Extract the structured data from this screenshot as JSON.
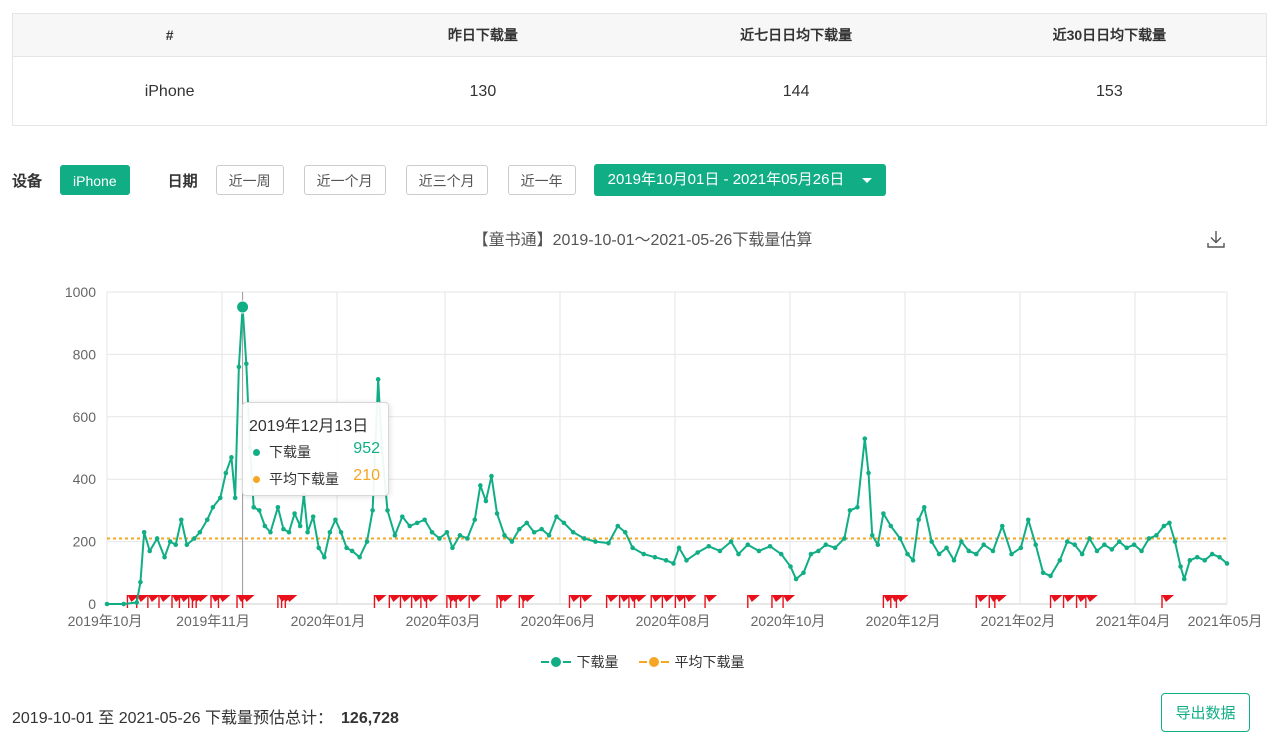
{
  "summary": {
    "headers": [
      "#",
      "昨日下载量",
      "近七日日均下载量",
      "近30日日均下载量"
    ],
    "row": [
      "iPhone",
      "130",
      "144",
      "153"
    ]
  },
  "filters": {
    "device_label": "设备",
    "device_selected": "iPhone",
    "date_label": "日期",
    "quick_ranges": [
      "近一周",
      "近一个月",
      "近三个月",
      "近一年"
    ],
    "date_range": "2019年10月01日 - 2021年05月26日"
  },
  "download_icon": "download-icon",
  "colors": {
    "accent": "#11ae86",
    "average": "#f5a623",
    "flag": "#e8101a"
  },
  "tooltip": {
    "date": "2019年12月13日",
    "rows": [
      {
        "name": "下载量",
        "value": "952"
      },
      {
        "name": "平均下载量",
        "value": "210"
      }
    ]
  },
  "footer": {
    "text": "2019-10-01 至 2021-05-26 下载量预估总计：",
    "total": "126,728",
    "export_label": "导出数据"
  },
  "chart_data": {
    "type": "line",
    "title": "【童书通】2019-10-01～2021-05-26下载量估算",
    "xlabel": "",
    "ylabel": "",
    "ylim": [
      0,
      1000
    ],
    "yticks": [
      0,
      200,
      400,
      600,
      800,
      1000
    ],
    "x_start": "2019-10-01",
    "x_end": "2021-05-26",
    "xticks": [
      "2019年10月",
      "2019年11月",
      "2020年01月",
      "2020年03月",
      "2020年06月",
      "2020年08月",
      "2020年10月",
      "2020年12月",
      "2021年02月",
      "2021年04月",
      "2021年05月"
    ],
    "grid": true,
    "legend_position": "bottom",
    "series": [
      {
        "name": "下载量",
        "color": "#11ae86",
        "points": [
          [
            "2019-10-01",
            0
          ],
          [
            "2019-10-10",
            0
          ],
          [
            "2019-10-17",
            5
          ],
          [
            "2019-10-19",
            70
          ],
          [
            "2019-10-21",
            230
          ],
          [
            "2019-10-24",
            170
          ],
          [
            "2019-10-28",
            210
          ],
          [
            "2019-11-01",
            150
          ],
          [
            "2019-11-04",
            200
          ],
          [
            "2019-11-07",
            190
          ],
          [
            "2019-11-10",
            270
          ],
          [
            "2019-11-13",
            190
          ],
          [
            "2019-11-17",
            210
          ],
          [
            "2019-11-20",
            230
          ],
          [
            "2019-11-24",
            270
          ],
          [
            "2019-11-27",
            310
          ],
          [
            "2019-12-01",
            340
          ],
          [
            "2019-12-04",
            420
          ],
          [
            "2019-12-07",
            470
          ],
          [
            "2019-12-09",
            340
          ],
          [
            "2019-12-11",
            760
          ],
          [
            "2019-12-13",
            952
          ],
          [
            "2019-12-15",
            770
          ],
          [
            "2019-12-17",
            500
          ],
          [
            "2019-12-19",
            310
          ],
          [
            "2019-12-22",
            300
          ],
          [
            "2019-12-25",
            250
          ],
          [
            "2019-12-28",
            230
          ],
          [
            "2020-01-01",
            310
          ],
          [
            "2020-01-04",
            240
          ],
          [
            "2020-01-07",
            230
          ],
          [
            "2020-01-10",
            290
          ],
          [
            "2020-01-13",
            250
          ],
          [
            "2020-01-15",
            350
          ],
          [
            "2020-01-17",
            230
          ],
          [
            "2020-01-20",
            280
          ],
          [
            "2020-01-23",
            180
          ],
          [
            "2020-01-26",
            150
          ],
          [
            "2020-01-29",
            230
          ],
          [
            "2020-02-01",
            270
          ],
          [
            "2020-02-04",
            230
          ],
          [
            "2020-02-07",
            180
          ],
          [
            "2020-02-10",
            170
          ],
          [
            "2020-02-14",
            150
          ],
          [
            "2020-02-18",
            200
          ],
          [
            "2020-02-21",
            300
          ],
          [
            "2020-02-24",
            720
          ],
          [
            "2020-02-26",
            500
          ],
          [
            "2020-02-29",
            300
          ],
          [
            "2020-03-04",
            220
          ],
          [
            "2020-03-08",
            280
          ],
          [
            "2020-03-12",
            250
          ],
          [
            "2020-03-16",
            260
          ],
          [
            "2020-03-20",
            270
          ],
          [
            "2020-03-24",
            230
          ],
          [
            "2020-03-28",
            210
          ],
          [
            "2020-04-01",
            230
          ],
          [
            "2020-04-04",
            180
          ],
          [
            "2020-04-08",
            220
          ],
          [
            "2020-04-12",
            210
          ],
          [
            "2020-04-16",
            270
          ],
          [
            "2020-04-19",
            380
          ],
          [
            "2020-04-22",
            330
          ],
          [
            "2020-04-25",
            410
          ],
          [
            "2020-04-28",
            290
          ],
          [
            "2020-05-02",
            220
          ],
          [
            "2020-05-06",
            200
          ],
          [
            "2020-05-10",
            240
          ],
          [
            "2020-05-14",
            260
          ],
          [
            "2020-05-18",
            230
          ],
          [
            "2020-05-22",
            240
          ],
          [
            "2020-05-26",
            220
          ],
          [
            "2020-05-30",
            280
          ],
          [
            "2020-06-03",
            260
          ],
          [
            "2020-06-08",
            230
          ],
          [
            "2020-06-14",
            210
          ],
          [
            "2020-06-20",
            200
          ],
          [
            "2020-06-27",
            195
          ],
          [
            "2020-07-02",
            250
          ],
          [
            "2020-07-06",
            230
          ],
          [
            "2020-07-10",
            180
          ],
          [
            "2020-07-16",
            160
          ],
          [
            "2020-07-22",
            150
          ],
          [
            "2020-07-28",
            140
          ],
          [
            "2020-08-01",
            130
          ],
          [
            "2020-08-04",
            180
          ],
          [
            "2020-08-08",
            140
          ],
          [
            "2020-08-14",
            165
          ],
          [
            "2020-08-20",
            185
          ],
          [
            "2020-08-26",
            170
          ],
          [
            "2020-09-01",
            200
          ],
          [
            "2020-09-05",
            160
          ],
          [
            "2020-09-10",
            190
          ],
          [
            "2020-09-16",
            170
          ],
          [
            "2020-09-22",
            185
          ],
          [
            "2020-09-28",
            160
          ],
          [
            "2020-10-03",
            120
          ],
          [
            "2020-10-06",
            80
          ],
          [
            "2020-10-10",
            100
          ],
          [
            "2020-10-14",
            160
          ],
          [
            "2020-10-18",
            170
          ],
          [
            "2020-10-22",
            190
          ],
          [
            "2020-10-27",
            180
          ],
          [
            "2020-11-01",
            210
          ],
          [
            "2020-11-04",
            300
          ],
          [
            "2020-11-08",
            310
          ],
          [
            "2020-11-12",
            530
          ],
          [
            "2020-11-14",
            420
          ],
          [
            "2020-11-16",
            220
          ],
          [
            "2020-11-19",
            190
          ],
          [
            "2020-11-22",
            290
          ],
          [
            "2020-11-26",
            250
          ],
          [
            "2020-12-01",
            210
          ],
          [
            "2020-12-05",
            160
          ],
          [
            "2020-12-08",
            140
          ],
          [
            "2020-12-11",
            270
          ],
          [
            "2020-12-14",
            310
          ],
          [
            "2020-12-18",
            200
          ],
          [
            "2020-12-22",
            160
          ],
          [
            "2020-12-26",
            180
          ],
          [
            "2020-12-30",
            140
          ],
          [
            "2021-01-03",
            200
          ],
          [
            "2021-01-07",
            170
          ],
          [
            "2021-01-11",
            160
          ],
          [
            "2021-01-15",
            190
          ],
          [
            "2021-01-20",
            170
          ],
          [
            "2021-01-25",
            250
          ],
          [
            "2021-01-30",
            160
          ],
          [
            "2021-02-04",
            180
          ],
          [
            "2021-02-08",
            270
          ],
          [
            "2021-02-12",
            190
          ],
          [
            "2021-02-16",
            100
          ],
          [
            "2021-02-20",
            90
          ],
          [
            "2021-02-25",
            140
          ],
          [
            "2021-03-01",
            200
          ],
          [
            "2021-03-05",
            190
          ],
          [
            "2021-03-09",
            160
          ],
          [
            "2021-03-13",
            210
          ],
          [
            "2021-03-17",
            170
          ],
          [
            "2021-03-21",
            190
          ],
          [
            "2021-03-25",
            175
          ],
          [
            "2021-03-29",
            200
          ],
          [
            "2021-04-02",
            180
          ],
          [
            "2021-04-06",
            190
          ],
          [
            "2021-04-10",
            170
          ],
          [
            "2021-04-14",
            210
          ],
          [
            "2021-04-18",
            220
          ],
          [
            "2021-04-22",
            250
          ],
          [
            "2021-04-25",
            260
          ],
          [
            "2021-04-28",
            200
          ],
          [
            "2021-05-01",
            120
          ],
          [
            "2021-05-03",
            80
          ],
          [
            "2021-05-06",
            140
          ],
          [
            "2021-05-10",
            150
          ],
          [
            "2021-05-14",
            140
          ],
          [
            "2021-05-18",
            160
          ],
          [
            "2021-05-22",
            150
          ],
          [
            "2021-05-26",
            130
          ]
        ]
      },
      {
        "name": "平均下载量",
        "color": "#f5a623",
        "constant": 210
      }
    ],
    "flag_dates": [
      "2019-10-12",
      "2019-10-17",
      "2019-10-23",
      "2019-10-29",
      "2019-11-05",
      "2019-11-09",
      "2019-11-14",
      "2019-11-16",
      "2019-11-18",
      "2019-11-26",
      "2019-11-30",
      "2019-12-10",
      "2019-12-13",
      "2020-01-01",
      "2020-01-03",
      "2020-01-05",
      "2020-02-22",
      "2020-03-01",
      "2020-03-07",
      "2020-03-13",
      "2020-03-18",
      "2020-03-21",
      "2020-04-01",
      "2020-04-03",
      "2020-04-06",
      "2020-04-13",
      "2020-04-28",
      "2020-04-30",
      "2020-05-10",
      "2020-05-12",
      "2020-06-06",
      "2020-06-12",
      "2020-06-26",
      "2020-07-03",
      "2020-07-08",
      "2020-07-11",
      "2020-07-20",
      "2020-07-26",
      "2020-08-02",
      "2020-08-07",
      "2020-08-18",
      "2020-09-10",
      "2020-09-23",
      "2020-09-29",
      "2020-11-22",
      "2020-11-26",
      "2020-11-29",
      "2021-01-11",
      "2021-01-18",
      "2021-01-21",
      "2021-02-20",
      "2021-02-27",
      "2021-03-06",
      "2021-03-11",
      "2021-04-21"
    ],
    "highlight": {
      "date": "2019-12-13",
      "value": 952
    }
  }
}
